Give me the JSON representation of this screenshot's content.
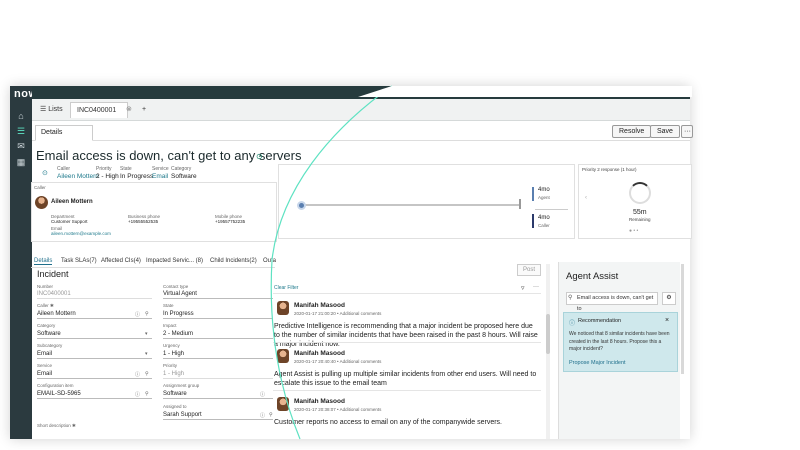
{
  "app": {
    "logo": "now"
  },
  "tabs": {
    "lists": "Lists",
    "record": "INC0400001",
    "add": "+"
  },
  "subtab": "Details",
  "actions": {
    "resolve": "Resolve",
    "save": "Save",
    "more": "···"
  },
  "record": {
    "title": "Email access is down, can't get to any servers",
    "meta": [
      {
        "label": "Caller",
        "value": "Aileen Mottern"
      },
      {
        "label": "Priority",
        "value": "2 - High"
      },
      {
        "label": "State",
        "value": "In Progress"
      },
      {
        "label": "Service",
        "value": "Email"
      },
      {
        "label": "Category",
        "value": "Software"
      }
    ]
  },
  "caller_card": {
    "heading": "Caller",
    "name": "Aileen Mottern",
    "department_label": "Department",
    "department": "Customer Support",
    "business_phone_label": "Business phone",
    "business_phone": "+19555552535",
    "mobile_phone_label": "Mobile phone",
    "mobile_phone": "+19557752235",
    "email_label": "Email",
    "email": "aileen.mottern@example.com"
  },
  "sla": {
    "agent_time": "4mo",
    "agent_label": "Agent",
    "caller_time": "4mo",
    "caller_label": "Caller",
    "priority_title": "Priority 2 response (1 hour)",
    "remaining_value": "55m",
    "remaining_label": "Remaining"
  },
  "form_tabs": [
    "Details",
    "Task SLAs(7)",
    "Affected CIs(4)",
    "Impacted Servic... (8)",
    "Child Incidents(2)",
    "Outa"
  ],
  "section": "Incident",
  "fields": {
    "number_label": "Number",
    "number": "INC0400001",
    "caller_label": "Caller ✱",
    "caller": "Aileen Mottern",
    "category_label": "Category",
    "category": "Software",
    "subcategory_label": "Subcategory",
    "subcategory": "Email",
    "service_label": "Service",
    "service": "Email",
    "ci_label": "Configuration item",
    "ci": "EMAIL-SD-5965",
    "short_desc_label": "Short description ✱",
    "contact_type_label": "Contact type",
    "contact_type": "Virtual Agent",
    "state_label": "State",
    "state": "In Progress",
    "impact_label": "Impact",
    "impact": "2 - Medium",
    "urgency_label": "Urgency",
    "urgency": "1 - High",
    "priority_label": "Priority",
    "priority": "1 - High",
    "group_label": "Assignment group",
    "group": "Software",
    "assigned_label": "Assigned to",
    "assigned": "Sarah Support"
  },
  "activity": {
    "post_button": "Post",
    "clear_filter": "Clear Filter",
    "entries": [
      {
        "author": "Manifah Masood",
        "date": "2020-01-17 21:00:20 • Additional comments",
        "text": "Predictive Intelligence is recommending that a major incident be proposed here due to the number of similar incidents that have been raised in the past 8 hours. Will raise a major incident now."
      },
      {
        "author": "Manifah Masood",
        "date": "2020-01-17 20:40:40 • Additional comments",
        "text": "Agent Assist is pulling up multiple similar incidents from other end users. Will need to escalate this issue to the email team"
      },
      {
        "author": "Manifah Masood",
        "date": "2020-01-17 20:38:07 • Additional comments",
        "text": "Customer reports no access to email on any of the companywide servers."
      }
    ]
  },
  "agent_assist": {
    "title": "Agent Assist",
    "search": "Email access is down, can't get to",
    "reco_title": "Recommendation",
    "reco_text": "We noticed that 8 similar incidents have been created in the last 8 hours. Propose this a major incident?",
    "reco_link": "Propose Major Incident"
  },
  "colors": {
    "accent": "#5ee2c2",
    "header": "#263b3d",
    "link": "#1f7a8c",
    "recommendation": "#cfe8ec"
  }
}
